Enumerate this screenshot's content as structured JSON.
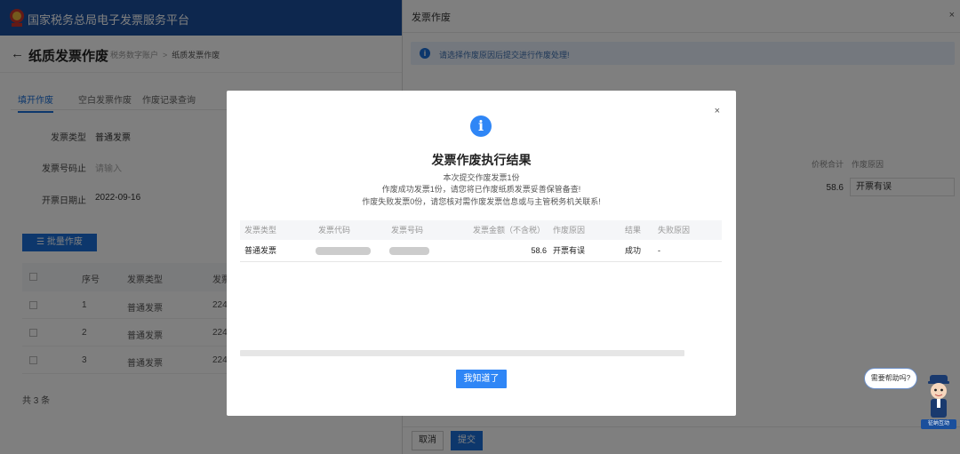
{
  "header": {
    "platform_name": "国家税务总局电子发票服务平台",
    "page_title": "纸质发票作废",
    "breadcrumb": [
      "税务数字账户",
      "纸质发票作废"
    ]
  },
  "tabs": [
    {
      "label": "填开作废",
      "active": true
    },
    {
      "label": "空白发票作废",
      "active": false
    },
    {
      "label": "作废记录查询",
      "active": false
    }
  ],
  "filters": {
    "invoice_type": {
      "label": "发票类型",
      "value": "普通发票"
    },
    "invoice_number_range": {
      "label": "发票号码止",
      "placeholder": "请输入"
    },
    "issue_date_end": {
      "label": "开票日期止",
      "value": "2022-09-16"
    }
  },
  "batch_button": "批量作废",
  "grid": {
    "columns": [
      "序号",
      "发票类型",
      "发票代码"
    ],
    "rows": [
      {
        "index": "1",
        "type": "普通发票",
        "code": "224"
      },
      {
        "index": "2",
        "type": "普通发票",
        "code": "224"
      },
      {
        "index": "3",
        "type": "普通发票",
        "code": "224"
      }
    ],
    "total": "共 3 条"
  },
  "drawer": {
    "title": "发票作废",
    "notice": "请选择作废原因后提交进行作废处理!",
    "columns": {
      "total": "价税合计",
      "reason": "作废原因"
    },
    "row": {
      "amount": "58.6",
      "reason": "开票有误"
    },
    "cancel_label": "取消",
    "submit_label": "提交"
  },
  "modal": {
    "icon": "i",
    "title": "发票作废执行结果",
    "summary_lines": [
      "本次提交作废发票1份",
      "作废成功发票1份，请您将已作废纸质发票妥善保管备查!",
      "作废失败发票0份，请您核对需作废发票信息或与主管税务机关联系!"
    ],
    "table": {
      "headers": [
        "发票类型",
        "发票代码",
        "发票号码",
        "发票金额（不含税）",
        "作废原因",
        "结果",
        "失败原因"
      ],
      "rows": [
        {
          "type": "普通发票",
          "amount": "58.6",
          "reason": "开票有误",
          "result": "成功",
          "fail_reason": "-"
        }
      ]
    },
    "confirm_label": "我知道了"
  },
  "helper": {
    "bubble": "需要帮助吗?",
    "label": "征纳互动"
  },
  "colors": {
    "primary": "#1a6fd8",
    "header_bg": "#1a4f9c",
    "modal_icon": "#2f86f6",
    "notice_bg": "#e8f1fc"
  }
}
